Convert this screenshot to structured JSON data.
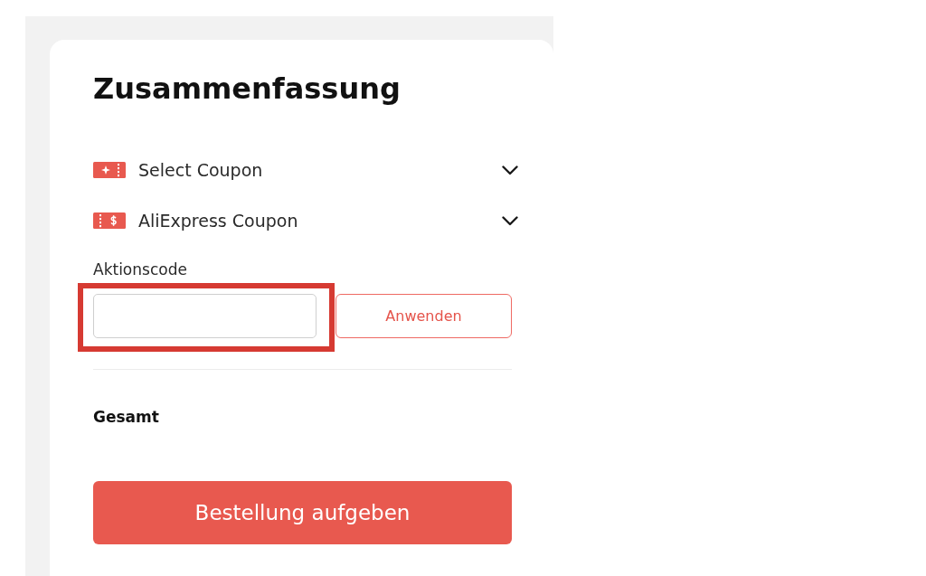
{
  "summary": {
    "title": "Zusammenfassung",
    "coupons": [
      {
        "kind": "plus",
        "label": "Select Coupon",
        "expanded": false
      },
      {
        "kind": "dollar",
        "label": "AliExpress Coupon",
        "expanded": false
      }
    ],
    "promo_code": {
      "label": "Aktionscode",
      "highlighted": true,
      "apply_button": "Anwenden"
    },
    "total": {
      "label": "Gesamt"
    },
    "order_button": "Bestellung aufgeben"
  }
}
